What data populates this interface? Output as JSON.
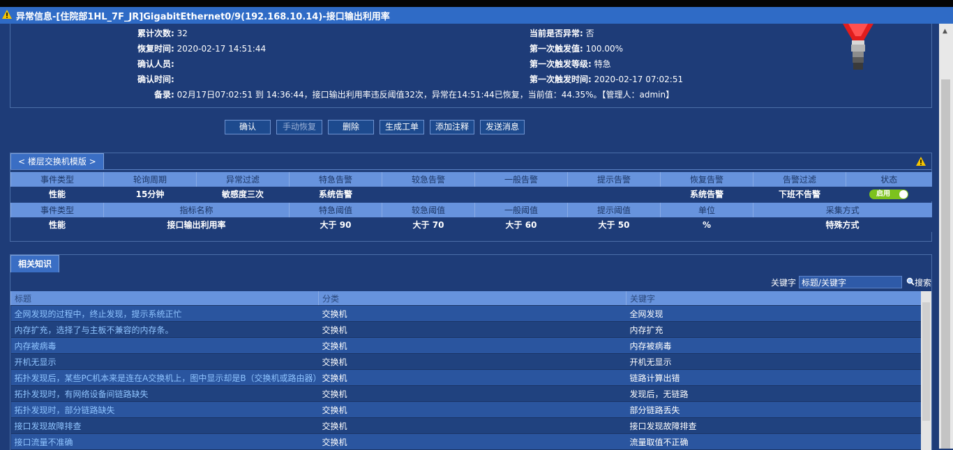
{
  "title": "异常信息-[住院部1HL_7F_JR]GigabitEthernet0/9(192.168.10.14)-接口输出利用率",
  "info": {
    "left": [
      {
        "label": "累计次数:",
        "value": "32"
      },
      {
        "label": "恢复时间:",
        "value": "2020-02-17 14:51:44"
      },
      {
        "label": "确认人员:",
        "value": ""
      },
      {
        "label": "确认时间:",
        "value": ""
      }
    ],
    "right": [
      {
        "label": "当前是否异常:",
        "value": "否"
      },
      {
        "label": "第一次触发值:",
        "value": "100.00%"
      },
      {
        "label": "第一次触发等级:",
        "value": "特急"
      },
      {
        "label": "第一次触发时间:",
        "value": "2020-02-17 07:02:51"
      }
    ],
    "remark_label": "备录:",
    "remark": "02月17日07:02:51 到 14:36:44，接口输出利用率违反阈值32次，异常在14:51:44已恢复，当前值：44.35%。【管理人：admin】"
  },
  "buttons": {
    "confirm": "确认",
    "manual_recover": "手动恢复",
    "delete": "删除",
    "gen_ticket": "生成工单",
    "add_note": "添加注释",
    "send_msg": "发送消息"
  },
  "template_panel": {
    "tab": "< 楼层交换机模版 >",
    "table1_headers": [
      "事件类型",
      "轮询周期",
      "异常过滤",
      "特急告警",
      "较急告警",
      "一般告警",
      "提示告警",
      "恢复告警",
      "告警过滤",
      "状态"
    ],
    "table1_row": [
      "性能",
      "15分钟",
      "敏感度三次",
      "系统告警",
      "",
      "",
      "",
      "系统告警",
      "下班不告警"
    ],
    "toggle_label": "启用",
    "table2_headers": [
      "事件类型",
      "指标名称",
      "特急阈值",
      "较急阈值",
      "一般阈值",
      "提示阈值",
      "单位",
      "采集方式"
    ],
    "table2_row": [
      "性能",
      "接口输出利用率",
      "大于 90",
      "大于 70",
      "大于 60",
      "大于 50",
      "%",
      "特殊方式"
    ]
  },
  "knowledge": {
    "tab": "相关知识",
    "keyword_label": "关键字",
    "keyword_placeholder": "标题/关键字",
    "search_label": "搜索",
    "headers": [
      "标题",
      "分类",
      "关键字"
    ],
    "rows": [
      [
        "全网发现的过程中，终止发现，提示系统正忙",
        "交换机",
        "全网发现"
      ],
      [
        "内存扩充，选择了与主板不兼容的内存条。",
        "交换机",
        "内存扩充"
      ],
      [
        "内存被病毒",
        "交换机",
        "内存被病毒"
      ],
      [
        "开机无显示",
        "交换机",
        "开机无显示"
      ],
      [
        "拓扑发现后，某些PC机本来是连在A交换机上，图中显示却是B（交换机或路由器）",
        "交换机",
        "链路计算出错"
      ],
      [
        "拓扑发现时，有网络设备间链路缺失",
        "交换机",
        "发现后，无链路"
      ],
      [
        "拓扑发现时，部分链路缺失",
        "交换机",
        "部分链路丢失"
      ],
      [
        "接口发现故障排查",
        "交换机",
        "接口发现故障排查"
      ],
      [
        "接口流量不准确",
        "交换机",
        "流量取值不正确"
      ]
    ]
  },
  "colors": {
    "background": "#1e3c78",
    "titlebar": "#2f6bc6",
    "header": "#6793dd",
    "toggle": "#7cc21d",
    "link": "#8fc4ff"
  }
}
